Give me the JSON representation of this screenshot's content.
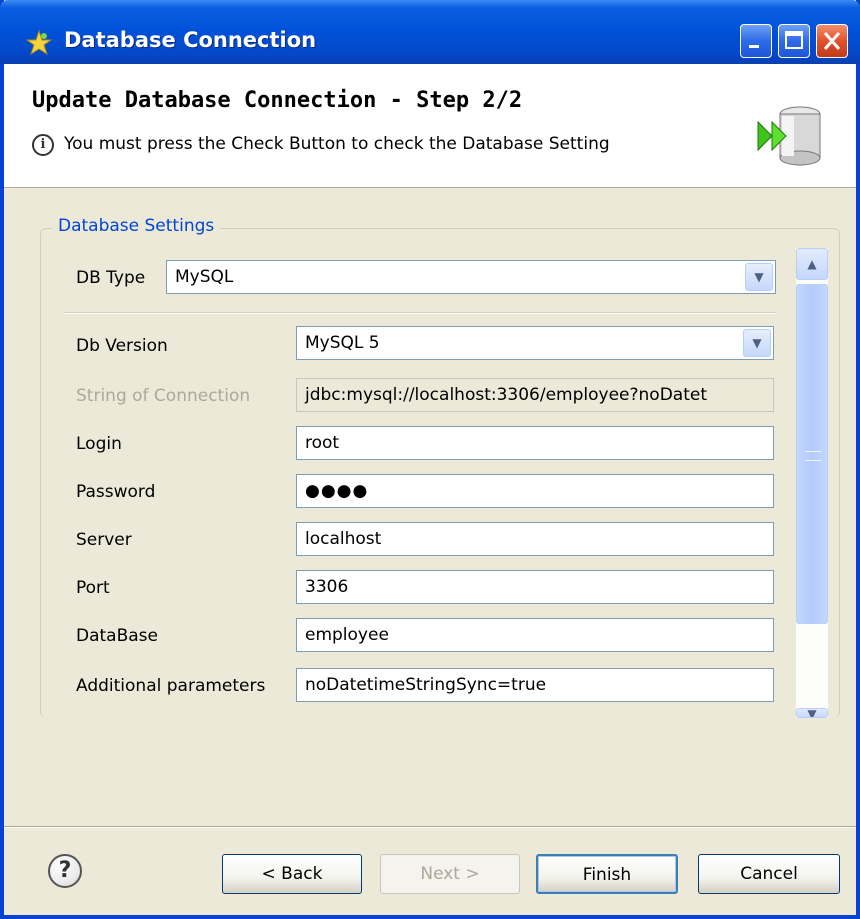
{
  "window": {
    "title": "Database Connection"
  },
  "header": {
    "title": "Update Database Connection - Step 2/2",
    "message": "You must press the Check Button to check the Database Setting"
  },
  "group": {
    "label": "Database Settings"
  },
  "form": {
    "db_type_label": "DB Type",
    "db_type_value": "MySQL",
    "db_version_label": "Db Version",
    "db_version_value": "MySQL 5",
    "connection_string_label": "String of Connection",
    "connection_string_value": "jdbc:mysql://localhost:3306/employee?noDatet",
    "login_label": "Login",
    "login_value": "root",
    "password_label": "Password",
    "password_value": "●●●●",
    "server_label": "Server",
    "server_value": "localhost",
    "port_label": "Port",
    "port_value": "3306",
    "database_label": "DataBase",
    "database_value": "employee",
    "additional_label": "Additional parameters",
    "additional_value": "noDatetimeStringSync=true"
  },
  "buttons": {
    "back": "< Back",
    "next": "Next >",
    "finish": "Finish",
    "cancel": "Cancel"
  },
  "icons": {
    "window_icon": "star-icon",
    "info": "info-icon",
    "database": "database-icon",
    "help": "help-icon"
  }
}
